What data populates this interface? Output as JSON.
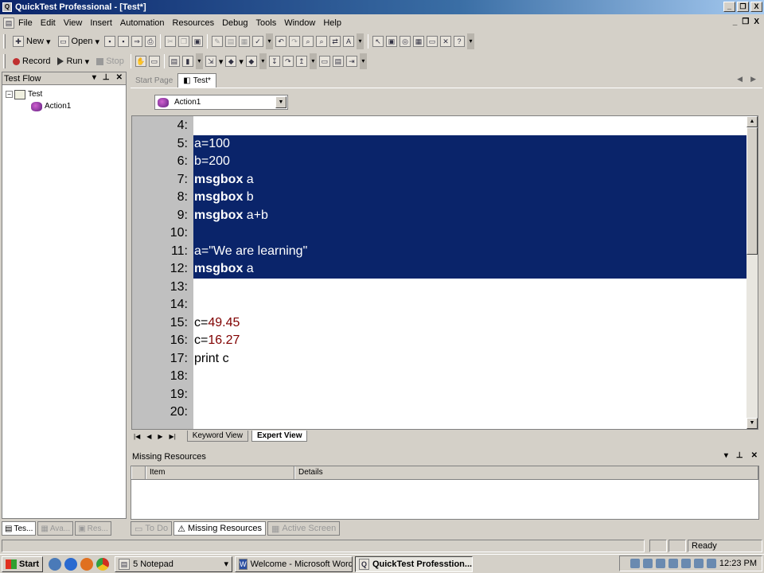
{
  "window": {
    "title": "QuickTest Professional - [Test*]",
    "controls": [
      "_",
      "❐",
      "X"
    ]
  },
  "menu": {
    "items": [
      "File",
      "Edit",
      "View",
      "Insert",
      "Automation",
      "Resources",
      "Debug",
      "Tools",
      "Window",
      "Help"
    ],
    "mdi_controls": [
      "_",
      "❐",
      "X"
    ]
  },
  "toolbar1": {
    "new_label": "New",
    "open_label": "Open"
  },
  "toolbar2": {
    "record_label": "Record",
    "run_label": "Run",
    "stop_label": "Stop"
  },
  "test_flow": {
    "title": "Test Flow",
    "root": "Test",
    "child": "Action1"
  },
  "left_tabs": [
    "Tes...",
    "Ava...",
    "Res..."
  ],
  "doc_tabs": {
    "start_page": "Start Page",
    "test": "Test*"
  },
  "action_selector": {
    "value": "Action1"
  },
  "editor": {
    "lines": [
      {
        "num": "4:",
        "code": "",
        "selected": false
      },
      {
        "num": "5:",
        "code": "a=100",
        "selected": true
      },
      {
        "num": "6:",
        "code": "b=200",
        "selected": true
      },
      {
        "num": "7:",
        "kw": "msgbox",
        "code": " a",
        "selected": true
      },
      {
        "num": "8:",
        "kw": "msgbox",
        "code": " b",
        "selected": true
      },
      {
        "num": "9:",
        "kw": "msgbox",
        "code": " a+b",
        "selected": true
      },
      {
        "num": "10:",
        "code": "",
        "selected": true
      },
      {
        "num": "11:",
        "code": "a=\"We are learning\"",
        "selected": true
      },
      {
        "num": "12:",
        "kw": "msgbox",
        "code": " a",
        "selected": true
      },
      {
        "num": "13:",
        "code": "",
        "selected": false
      },
      {
        "num": "14:",
        "code": "",
        "selected": false
      },
      {
        "num": "15:",
        "code": "c=",
        "lit": "49.45",
        "selected": false
      },
      {
        "num": "16:",
        "code": "c=",
        "lit": "16.27",
        "selected": false
      },
      {
        "num": "17:",
        "code": "print c",
        "selected": false
      },
      {
        "num": "18:",
        "code": "",
        "selected": false
      },
      {
        "num": "19:",
        "code": "",
        "selected": false
      },
      {
        "num": "20:",
        "code": "",
        "selected": false
      }
    ]
  },
  "view_tabs": {
    "keyword": "Keyword View",
    "expert": "Expert View"
  },
  "missing_resources": {
    "title": "Missing Resources",
    "col_item": "Item",
    "col_details": "Details"
  },
  "bottom_tabs": {
    "todo": "To Do",
    "missing": "Missing Resources",
    "active_screen": "Active Screen"
  },
  "status": {
    "text": "Ready"
  },
  "taskbar": {
    "start": "Start",
    "tasks": [
      "5 Notepad",
      "Welcome - Microsoft Word",
      "QuickTest Professtion..."
    ],
    "clock": "12:23 PM"
  },
  "colors": {
    "selection": "#0a246a",
    "number_literal": "#800000",
    "gutter": "#c0c0c0"
  }
}
